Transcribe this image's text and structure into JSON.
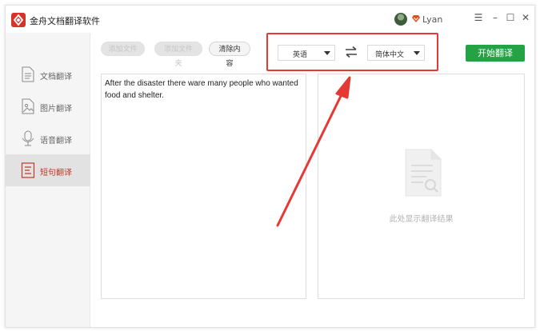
{
  "app": {
    "title": "金舟文档翻译软件",
    "username": "Lyan",
    "window_controls": [
      "☰",
      "–",
      "☐",
      "✕"
    ]
  },
  "sidebar": {
    "items": [
      {
        "label": "文档翻译",
        "icon": "document-icon",
        "active": false
      },
      {
        "label": "图片翻译",
        "icon": "image-icon",
        "active": false
      },
      {
        "label": "语音翻译",
        "icon": "microphone-icon",
        "active": false
      },
      {
        "label": "短句翻译",
        "icon": "text-lines-icon",
        "active": true
      }
    ]
  },
  "toolbar": {
    "add_file_label": "添加文件",
    "add_folder_label": "添加文件夹",
    "clear_label": "清除内容",
    "source_language": "英语",
    "target_language": "简体中文",
    "start_label": "开始翻译"
  },
  "source_panel": {
    "text": "After the disaster there ware many people who wanted food and shelter."
  },
  "result_panel": {
    "placeholder": "此处显示翻译结果"
  },
  "colors": {
    "accent_green": "#25a244",
    "annotation_red": "#e53935",
    "active_nav": "#c0392b"
  }
}
